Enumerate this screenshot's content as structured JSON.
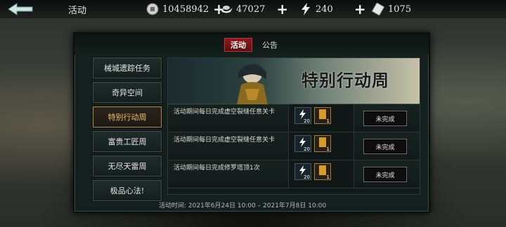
{
  "topbar": {
    "title": "活动",
    "resources": [
      {
        "name": "coin",
        "icon": "coin-icon",
        "value": "10458942"
      },
      {
        "name": "ingot",
        "icon": "ingot-icon",
        "value": "47027"
      },
      {
        "name": "stamina",
        "icon": "lightning-icon",
        "value": "240"
      },
      {
        "name": "ticket",
        "icon": "ticket-icon",
        "value": "1075"
      }
    ],
    "plus": "+"
  },
  "tabs": [
    {
      "label": "活动",
      "active": true
    },
    {
      "label": "公告",
      "active": false
    }
  ],
  "sidebar": {
    "items": [
      {
        "label": "械城遗踪任务"
      },
      {
        "label": "奇异空间"
      },
      {
        "label": "特别行动周",
        "active": true
      },
      {
        "label": "富贵工匠周"
      },
      {
        "label": "无尽天雷周"
      },
      {
        "label": "极品心法!"
      }
    ]
  },
  "banner": {
    "title": "特别行动周"
  },
  "tasks": [
    {
      "desc": "活动期间每日完成虚空裂缝任意关卡",
      "rewards": [
        {
          "icon": "lightning-icon",
          "count": "20"
        },
        {
          "icon": "gold-ticket-icon",
          "count": "1"
        }
      ],
      "status": "未完成"
    },
    {
      "desc": "活动期间每日完成虚空裂缝任意关卡",
      "rewards": [
        {
          "icon": "lightning-icon",
          "count": "20"
        },
        {
          "icon": "gold-ticket-icon",
          "count": "1"
        }
      ],
      "status": "未完成"
    },
    {
      "desc": "活动期间每日完成修罗塔顶1次",
      "rewards": [
        {
          "icon": "lightning-icon",
          "count": "20"
        },
        {
          "icon": "gold-ticket-icon",
          "count": "1"
        }
      ],
      "status": "未完成"
    }
  ],
  "footer": {
    "label": "活动时间:",
    "period": "2021年6月24日 10:00 – 2021年7月8日 10:00"
  },
  "colors": {
    "accent_red": "#8e1b1b",
    "gold": "#f0c060",
    "panel_bg": "#14201d"
  }
}
